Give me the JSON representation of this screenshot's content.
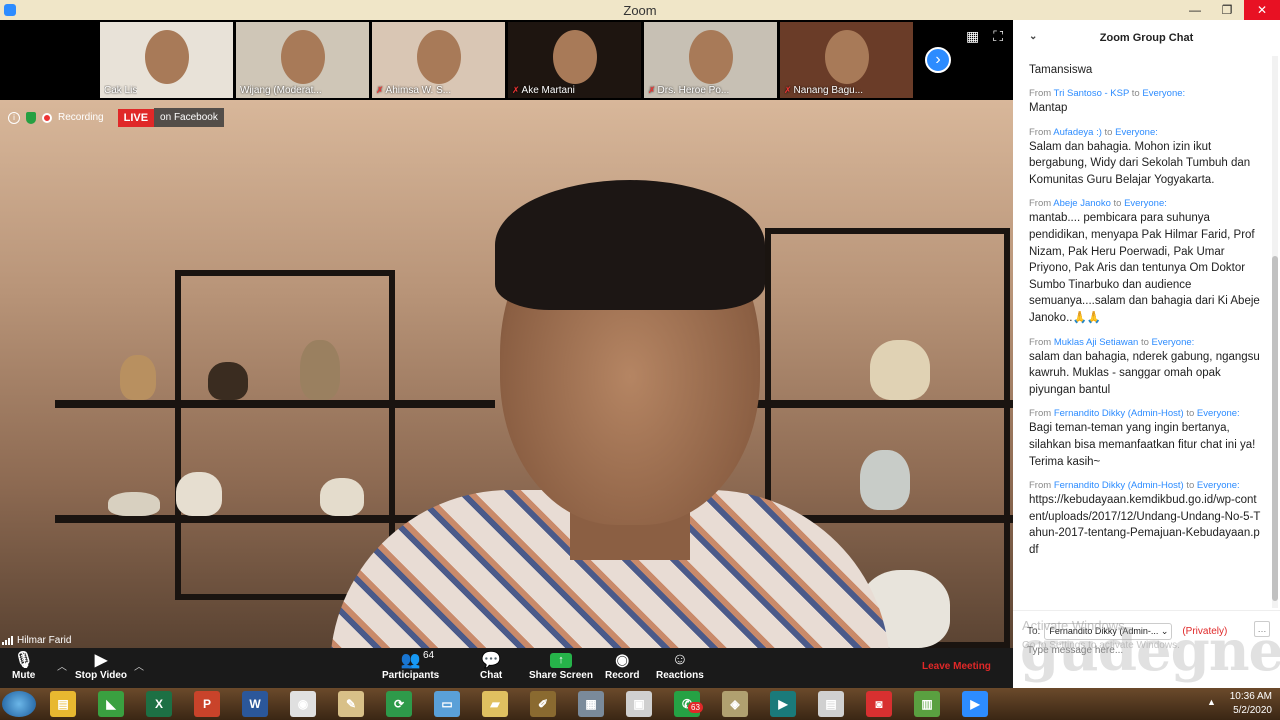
{
  "window": {
    "title": "Zoom",
    "controls": {
      "minimize": "—",
      "maximize": "❐",
      "close": "✕"
    }
  },
  "thumbnails": [
    {
      "name": "Cak Lis",
      "muted": false,
      "bg": "#e8e2d8"
    },
    {
      "name": "Wijang (Moderat...",
      "muted": false,
      "bg": "#cfc6b7"
    },
    {
      "name": "Ahimsa W. S...",
      "muted": true,
      "bg": "#d9c6b4"
    },
    {
      "name": "Ake Martani",
      "muted": true,
      "bg": "#1e1510"
    },
    {
      "name": "Drs. Heroe Po...",
      "muted": true,
      "bg": "#c7c0b4"
    },
    {
      "name": "Nanang Bagu...",
      "muted": true,
      "bg": "#6a3c28"
    }
  ],
  "main_video": {
    "speaker": "Hilmar Farid",
    "recording_label": "Recording",
    "live_label": "LIVE",
    "live_platform": "on Facebook"
  },
  "toolbar": {
    "mute": "Mute",
    "stop_video": "Stop Video",
    "participants": "Participants",
    "participants_count": "64",
    "chat": "Chat",
    "share_screen": "Share Screen",
    "record": "Record",
    "reactions": "Reactions",
    "leave": "Leave Meeting"
  },
  "chat": {
    "title": "Zoom Group Chat",
    "partial_top": "Tamansiswa",
    "messages": [
      {
        "from": "Tri Santoso - KSP",
        "to": "Everyone",
        "text": "Mantap"
      },
      {
        "from": "Aufadeya :)",
        "to": "Everyone",
        "text": "Salam dan bahagia. Mohon izin ikut bergabung, Widy dari Sekolah Tumbuh dan Komunitas Guru Belajar Yogyakarta."
      },
      {
        "from": "Abeje Janoko",
        "to": "Everyone",
        "text": "mantab.... pembicara para suhunya pendidikan, menyapa Pak Hilmar Farid, Prof Nizam, Pak Heru Poerwadi, Pak Umar Priyono, Pak Aris dan tentunya Om Doktor Sumbo Tinarbuko dan audience semuanya....salam dan bahagia dari Ki Abeje Janoko..🙏🙏"
      },
      {
        "from": "Muklas Aji Setiawan",
        "to": "Everyone",
        "text": "salam dan bahagia, nderek gabung, ngangsu kawruh. Muklas - sanggar omah opak piyungan bantul"
      },
      {
        "from": "Fernandito Dikky (Admin-Host)",
        "to": "Everyone",
        "text": "Bagi teman-teman yang ingin bertanya, silahkan bisa memanfaatkan fitur chat ini ya! Terima kasih~"
      },
      {
        "from": "Fernandito Dikky (Admin-Host)",
        "to": "Everyone",
        "text": "https://kebudayaan.kemdikbud.go.id/wp-content/uploads/2017/12/Undang-Undang-No-5-Tahun-2017-tentang-Pemajuan-Kebudayaan.pdf"
      }
    ],
    "from_word": "From",
    "to_word": "to",
    "to_label": "To:",
    "recipient": "Fernandito Dikky (Admin-...",
    "privately": "(Privately)",
    "input_placeholder": "Type message here..."
  },
  "overlay": {
    "activate_title": "Activate Windows",
    "activate_sub": "Go to Settings to activate Windows.",
    "watermark": "gudegnet",
    "watermark_sub": "GUDANG INFO KOTA"
  },
  "taskbar": {
    "apps": [
      {
        "name": "file-explorer",
        "color": "#e8b830",
        "glyph": "▤"
      },
      {
        "name": "app-green",
        "color": "#3aa040",
        "glyph": "◣"
      },
      {
        "name": "excel",
        "color": "#1d7044",
        "glyph": "X"
      },
      {
        "name": "powerpoint",
        "color": "#c9432a",
        "glyph": "P"
      },
      {
        "name": "word",
        "color": "#2b579a",
        "glyph": "W"
      },
      {
        "name": "chrome",
        "color": "#e0e0e0",
        "glyph": "◉"
      },
      {
        "name": "paint",
        "color": "#d8c088",
        "glyph": "✎"
      },
      {
        "name": "sync",
        "color": "#2e9a4a",
        "glyph": "⟳"
      },
      {
        "name": "notepad",
        "color": "#5aa0d8",
        "glyph": "▭"
      },
      {
        "name": "folder",
        "color": "#e0c060",
        "glyph": "▰"
      },
      {
        "name": "tool",
        "color": "#8a6a30",
        "glyph": "✐"
      },
      {
        "name": "calculator",
        "color": "#7a8a9a",
        "glyph": "▦"
      },
      {
        "name": "calendar",
        "color": "#d0d0d0",
        "glyph": "▣"
      },
      {
        "name": "whatsapp",
        "color": "#25a244",
        "glyph": "✆"
      },
      {
        "name": "app-car",
        "color": "#b0a070",
        "glyph": "◈"
      },
      {
        "name": "app-teal",
        "color": "#1a7a7a",
        "glyph": "▶"
      },
      {
        "name": "docs",
        "color": "#d0d0d0",
        "glyph": "▤"
      },
      {
        "name": "camera",
        "color": "#d83030",
        "glyph": "◙"
      },
      {
        "name": "android",
        "color": "#5aa040",
        "glyph": "▥"
      },
      {
        "name": "zoom",
        "color": "#2d8cff",
        "glyph": "▶"
      }
    ],
    "whatsapp_badge": "63",
    "time": "10:36 AM",
    "date": "5/2/2020"
  }
}
